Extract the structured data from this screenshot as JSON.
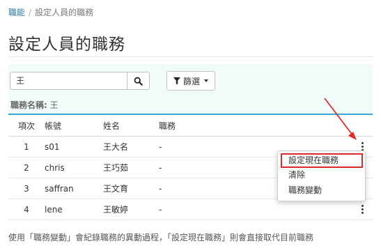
{
  "breadcrumb": {
    "root": "職能",
    "separator": "/",
    "current": "設定人員的職務"
  },
  "page": {
    "title": "設定人員的職務"
  },
  "search": {
    "value": "王",
    "icon": "search-icon"
  },
  "filter": {
    "label": "篩選",
    "icon": "filter-icon"
  },
  "filter_summary": {
    "key": "職務名稱:",
    "value": "王"
  },
  "table": {
    "headers": [
      "項次",
      "帳號",
      "姓名",
      "職務"
    ],
    "rows": [
      {
        "no": "1",
        "account": "s01",
        "name": "王大名",
        "role": "-"
      },
      {
        "no": "2",
        "account": "chris",
        "name": "王巧茹",
        "role": "-"
      },
      {
        "no": "3",
        "account": "saffran",
        "name": "王文育",
        "role": "-"
      },
      {
        "no": "4",
        "account": "lene",
        "name": "王敏婷",
        "role": "-"
      }
    ]
  },
  "context_menu": {
    "items": [
      "設定現在職務",
      "清除",
      "職務變動"
    ],
    "highlighted": "設定現在職務"
  },
  "footer": {
    "note": "使用「職務變動」會紀錄職務的異動過程，「設定現在職務」則會直接取代目前職務"
  },
  "colors": {
    "link": "#2a7ab0",
    "accent": "#39a9d8",
    "panel_bg": "#f1fbfa",
    "highlight": "#dd2b2b"
  }
}
